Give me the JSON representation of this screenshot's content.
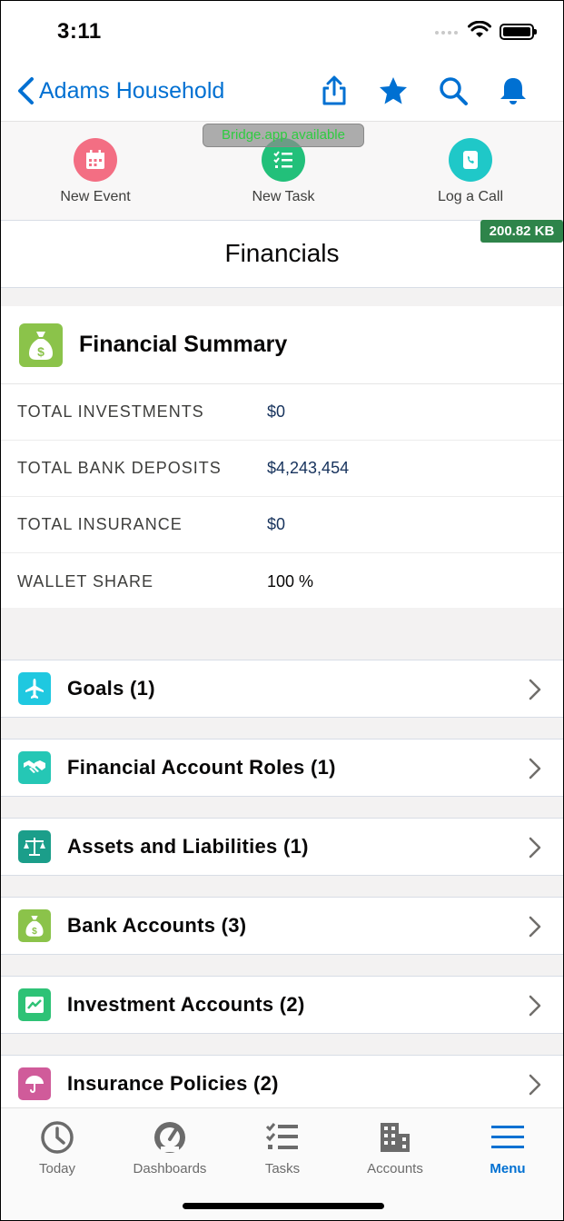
{
  "status_bar": {
    "time": "3:11"
  },
  "nav": {
    "back_label": "Adams Household"
  },
  "quick_actions": [
    {
      "label": "New Event",
      "color": "#f36e83"
    },
    {
      "label": "New Task",
      "color": "#22c07a"
    },
    {
      "label": "Log a Call",
      "color": "#1fc8c8"
    }
  ],
  "overlays": {
    "toast": "Bridge.app available",
    "memory": "200.82 KB"
  },
  "page": {
    "title": "Financials"
  },
  "summary": {
    "title": "Financial Summary",
    "rows": [
      {
        "label": "TOTAL INVESTMENTS",
        "value": "$0"
      },
      {
        "label": "TOTAL BANK DEPOSITS",
        "value": "$4,243,454"
      },
      {
        "label": "TOTAL INSURANCE",
        "value": "$0"
      },
      {
        "label": "WALLET SHARE",
        "value": "100 %"
      }
    ]
  },
  "related_lists": [
    {
      "label": "Goals (1)",
      "icon": "airplane-icon",
      "color": "#1fc8e0"
    },
    {
      "label": "Financial Account Roles (1)",
      "icon": "handshake-icon",
      "color": "#25c7b5"
    },
    {
      "label": "Assets and Liabilities (1)",
      "icon": "scales-icon",
      "color": "#1b9e8a"
    },
    {
      "label": "Bank Accounts (3)",
      "icon": "money-bag-icon",
      "color": "#8bc34a"
    },
    {
      "label": "Investment Accounts (2)",
      "icon": "chart-icon",
      "color": "#2ec276"
    },
    {
      "label": "Insurance Policies (2)",
      "icon": "umbrella-icon",
      "color": "#d05b9a"
    }
  ],
  "tabs": [
    {
      "label": "Today",
      "icon": "clock-icon"
    },
    {
      "label": "Dashboards",
      "icon": "gauge-icon"
    },
    {
      "label": "Tasks",
      "icon": "checklist-icon"
    },
    {
      "label": "Accounts",
      "icon": "building-icon"
    },
    {
      "label": "Menu",
      "icon": "hamburger-icon",
      "active": true
    }
  ],
  "colors": {
    "accent": "#0070d2"
  }
}
